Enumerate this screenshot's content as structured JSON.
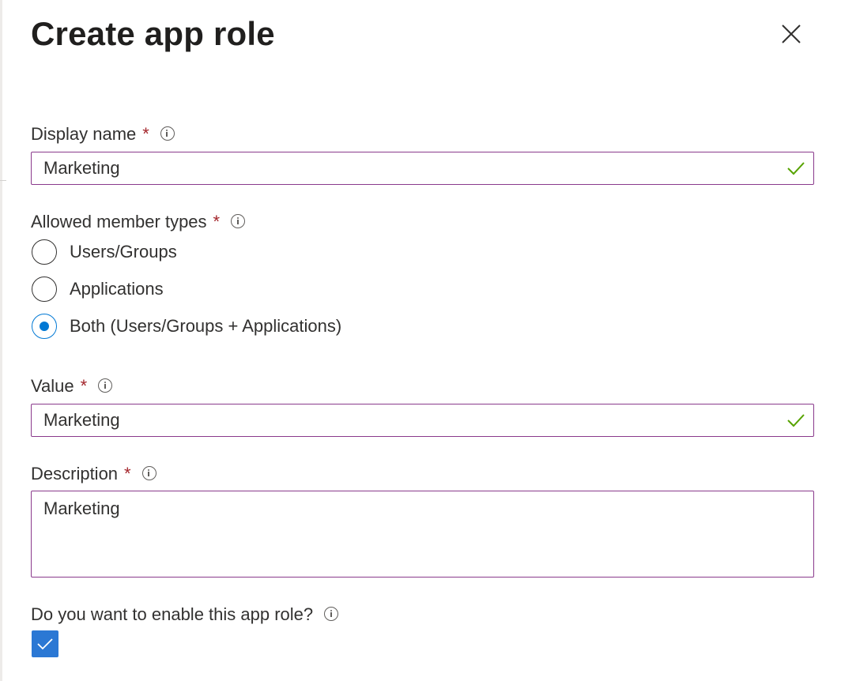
{
  "panel": {
    "title": "Create app role"
  },
  "display_name": {
    "label": "Display name",
    "required_mark": "*",
    "value": "Marketing"
  },
  "member_types": {
    "label": "Allowed member types",
    "required_mark": "*",
    "options": [
      {
        "label": "Users/Groups",
        "selected": false
      },
      {
        "label": "Applications",
        "selected": false
      },
      {
        "label": "Both (Users/Groups + Applications)",
        "selected": true
      }
    ]
  },
  "value_field": {
    "label": "Value",
    "required_mark": "*",
    "value": "Marketing"
  },
  "description": {
    "label": "Description",
    "required_mark": "*",
    "value": "Marketing"
  },
  "enable": {
    "label": "Do you want to enable this app role?",
    "checked": true
  },
  "colors": {
    "accent": "#0078d4",
    "required": "#a4262c",
    "field_border": "#8a3a8c",
    "valid_check": "#57a300"
  },
  "icons": {
    "close": "close-icon",
    "info": "info-icon",
    "valid": "checkmark-icon"
  }
}
